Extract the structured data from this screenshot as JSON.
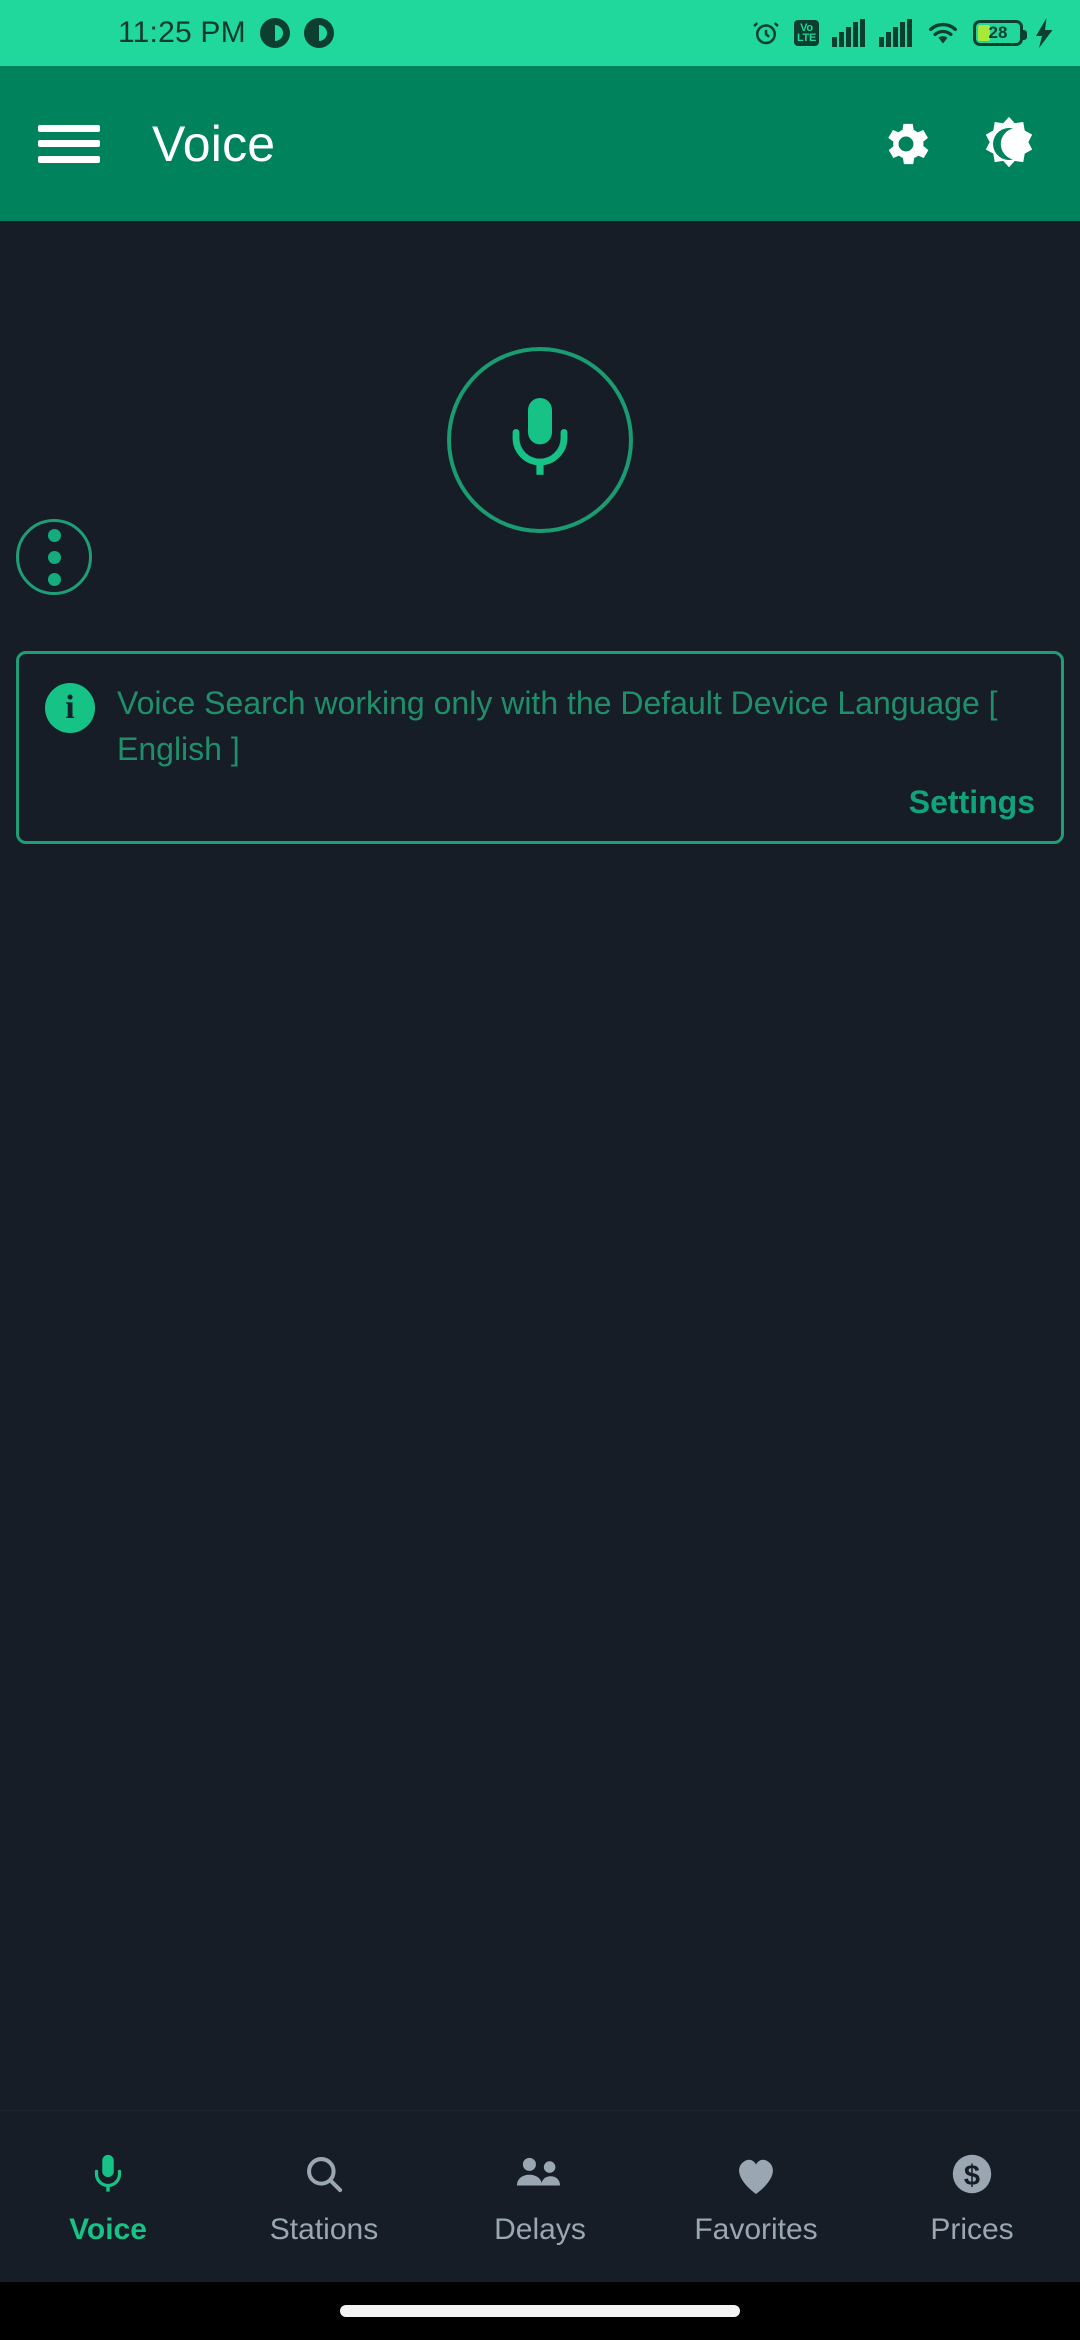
{
  "statusbar": {
    "time": "11:25 PM",
    "icons": [
      "notification-dot-icon",
      "notification-dot-icon",
      "alarm-icon",
      "volte-icon",
      "signal-sim1-icon",
      "signal-sim2-icon",
      "wifi-icon",
      "battery-icon",
      "charging-bolt-icon"
    ],
    "volte_label_top": "Vo",
    "volte_label_bottom": "LTE",
    "battery_percent": "28"
  },
  "appbar": {
    "title": "Voice",
    "menu_icon": "hamburger-menu-icon",
    "settings_icon": "gear-icon",
    "theme_icon": "dark-mode-toggle-icon"
  },
  "content": {
    "overflow_icon": "more-vertical-icon",
    "mic_icon": "microphone-icon",
    "banner": {
      "info_icon": "info-icon",
      "text": "Voice Search working only with the Default Device Language [ English ]",
      "action_label": "Settings"
    }
  },
  "bottomnav": {
    "items": [
      {
        "label": "Voice",
        "icon": "microphone-icon",
        "active": true
      },
      {
        "label": "Stations",
        "icon": "search-icon",
        "active": false
      },
      {
        "label": "Delays",
        "icon": "people-icon",
        "active": false
      },
      {
        "label": "Favorites",
        "icon": "heart-icon",
        "active": false
      },
      {
        "label": "Prices",
        "icon": "dollar-circle-icon",
        "active": false
      }
    ]
  },
  "colors": {
    "statusbar_bg": "#20d79c",
    "appbar_bg": "#00825d",
    "page_bg": "#171d26",
    "accent": "#17c286",
    "accent_dim": "#1f8f6b",
    "inactive": "#9aa6b2"
  }
}
